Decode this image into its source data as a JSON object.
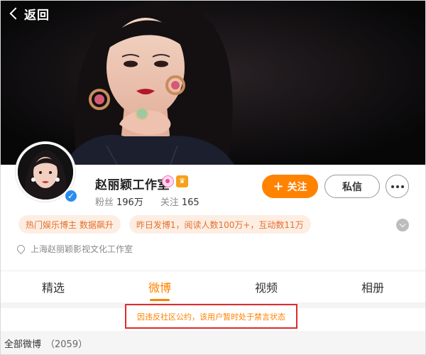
{
  "header": {
    "back_label": "返回"
  },
  "profile": {
    "name": "赵丽颖工作室",
    "badges": [
      "pink-circle-badge",
      "gold-badge"
    ],
    "fans_label": "粉丝",
    "fans_value": "196万",
    "following_label": "关注",
    "following_value": "165",
    "verified_icon": "verified-v-icon",
    "follow_label": "关注",
    "message_label": "私信",
    "tags": [
      "热门娱乐博主 数据飙升",
      "昨日发博1，阅读人数100万+，互动数11万"
    ],
    "company": "上海赵丽颖影视文化工作室"
  },
  "tabs": [
    {
      "label": "精选",
      "active": false
    },
    {
      "label": "微博",
      "active": true
    },
    {
      "label": "视频",
      "active": false
    },
    {
      "label": "相册",
      "active": false
    }
  ],
  "notice": "因违反社区公约，该用户暂时处于禁言状态",
  "feed": {
    "label": "全部微博",
    "count": "（2059）"
  },
  "colors": {
    "accent": "#ff8200",
    "notice_border": "#e02b2b",
    "tag_bg": "#fdeee4",
    "tag_text": "#e6702a",
    "verify": "#2a8cf0"
  }
}
